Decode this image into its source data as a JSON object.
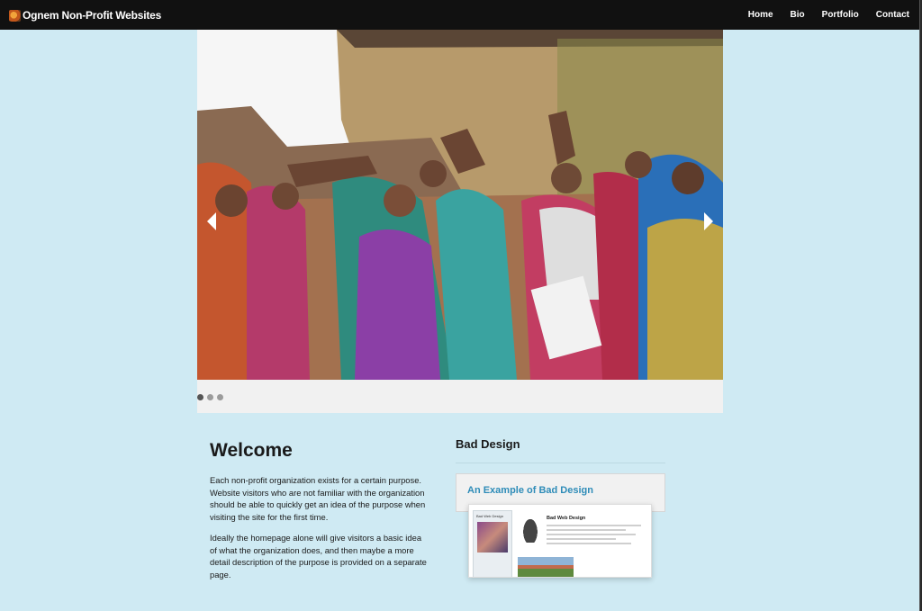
{
  "brand": {
    "name": "Ognem Non-Profit Websites",
    "logo_icon": "brand-logo-icon"
  },
  "nav": {
    "items": [
      "Home",
      "Bio",
      "Portfolio",
      "Contact"
    ]
  },
  "slider": {
    "image_description_icon": "photo-icon",
    "prev_icon": "chevron-left-icon",
    "next_icon": "chevron-right-icon",
    "slide_count": 3,
    "active_slide": 1
  },
  "welcome": {
    "heading": "Welcome",
    "paragraphs": [
      "Each non-profit organization exists for a certain purpose. Website visitors who are not familiar with the organization should be able to quickly get an idea of the purpose when visiting the site for the first time.",
      "Ideally the homepage alone will give visitors a basic idea of what the organization does, and then maybe a more detail description of the purpose is provided on a separate page."
    ]
  },
  "bad_design": {
    "heading": "Bad Design",
    "card_title": "An Example of Bad Design",
    "thumb": {
      "side_title": "Bad Web Design",
      "main_title": "Bad Web Design"
    }
  },
  "colors": {
    "background": "#cfeaf3",
    "topbar": "#111111",
    "link": "#2e8cb8"
  }
}
